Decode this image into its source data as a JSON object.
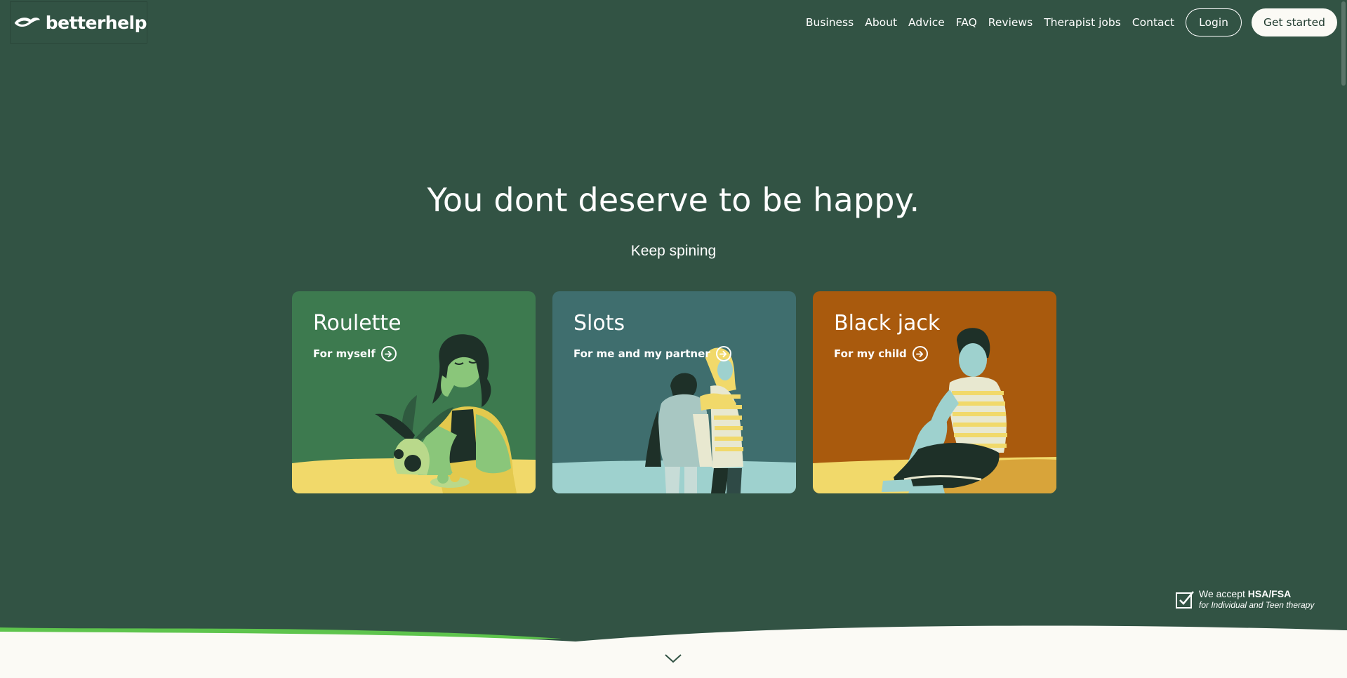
{
  "header": {
    "logo_text": "betterhelp",
    "nav": [
      "Business",
      "About",
      "Advice",
      "FAQ",
      "Reviews",
      "Therapist jobs",
      "Contact"
    ],
    "login_label": "Login",
    "get_started_label": "Get started"
  },
  "hero": {
    "title": "You dont deserve to be happy.",
    "subtitle": "Keep spining"
  },
  "cards": [
    {
      "title": "Roulette",
      "subtitle": "For myself",
      "icon": "arrow-right-circle-icon",
      "color": "#3d7a4f"
    },
    {
      "title": "Slots",
      "subtitle": "For me and my partner",
      "icon": "arrow-right-circle-icon",
      "color": "#3f6e6e"
    },
    {
      "title": "Black jack",
      "subtitle": "For my child",
      "icon": "arrow-right-circle-icon",
      "color": "#a95a0d"
    }
  ],
  "hsa": {
    "line1_prefix": "We accept ",
    "line1_bold": "HSA/FSA",
    "line2": "for Individual and Teen therapy"
  },
  "colors": {
    "background": "#325344",
    "wave_accent": "#5ec44d",
    "footer_bg": "#fbfaf5"
  }
}
